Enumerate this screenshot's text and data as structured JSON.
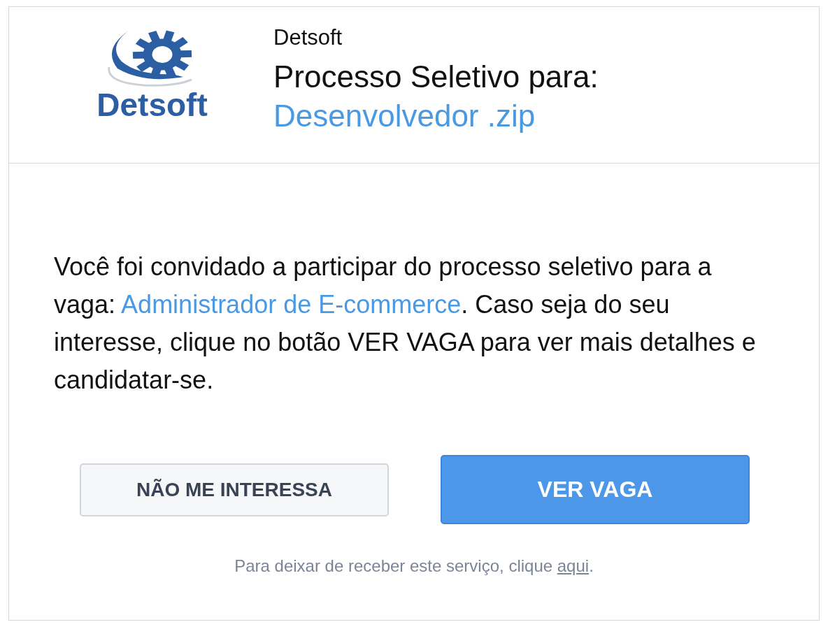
{
  "header": {
    "logo": {
      "text": "Detsoft"
    },
    "company": "Detsoft",
    "title": "Processo Seletivo para:",
    "position": "Desenvolvedor .zip"
  },
  "message": {
    "text_before": "Você foi convidado a participar do processo seletivo para a vaga: ",
    "link": "Administrador de E-commerce",
    "text_after": ". Caso seja do seu interesse, clique no botão VER VAGA para ver mais detalhes e candidatar-se."
  },
  "buttons": [
    {
      "label": "NÃO ME INTERESSA",
      "kind": "secondary"
    },
    {
      "label": "VER VAGA",
      "kind": "primary"
    }
  ],
  "footer": {
    "text_before": "Para deixar de receber este serviço, clique ",
    "link": "aqui",
    "text_after": "."
  }
}
